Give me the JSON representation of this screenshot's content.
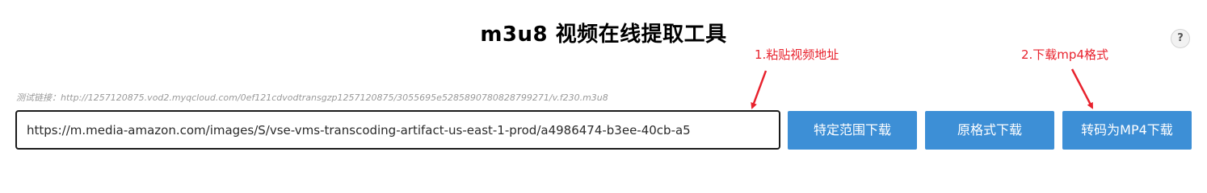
{
  "page": {
    "title": "m3u8 视频在线提取工具",
    "help_label": "?"
  },
  "annotations": {
    "step1": "1.粘贴视频地址",
    "step2": "2.下载mp4格式",
    "color": "#e8222d"
  },
  "example": {
    "text": "测试链接：http://1257120875.vod2.myqcloud.com/0ef121cdvodtransgzp1257120875/3055695e5285890780828799271/v.f230.m3u8"
  },
  "input": {
    "value": "https://m.media-amazon.com/images/S/vse-vms-transcoding-artifact-us-east-1-prod/a4986474-b3ee-40cb-a5"
  },
  "buttons": {
    "range_download": "特定范围下载",
    "original_download": "原格式下载",
    "mp4_download": "转码为MP4下载",
    "color": "#3d8fd6"
  }
}
